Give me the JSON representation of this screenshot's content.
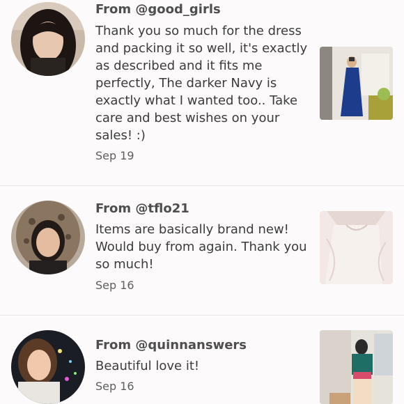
{
  "reviews": [
    {
      "from": "From @good_girls",
      "message": "Thank you so much for the dress and packing it so well, it's exactly as described and it fits me perfectly, The darker Navy is exactly what I wanted too.. Take care and best wishes on your sales! :)",
      "date": "Sep 19"
    },
    {
      "from": "From @tflo21",
      "message": "Items are basically brand new! Would buy from again. Thank you so much!",
      "date": "Sep 16"
    },
    {
      "from": "From @quinnanswers",
      "message": "Beautiful love it!",
      "date": "Sep 16"
    }
  ]
}
